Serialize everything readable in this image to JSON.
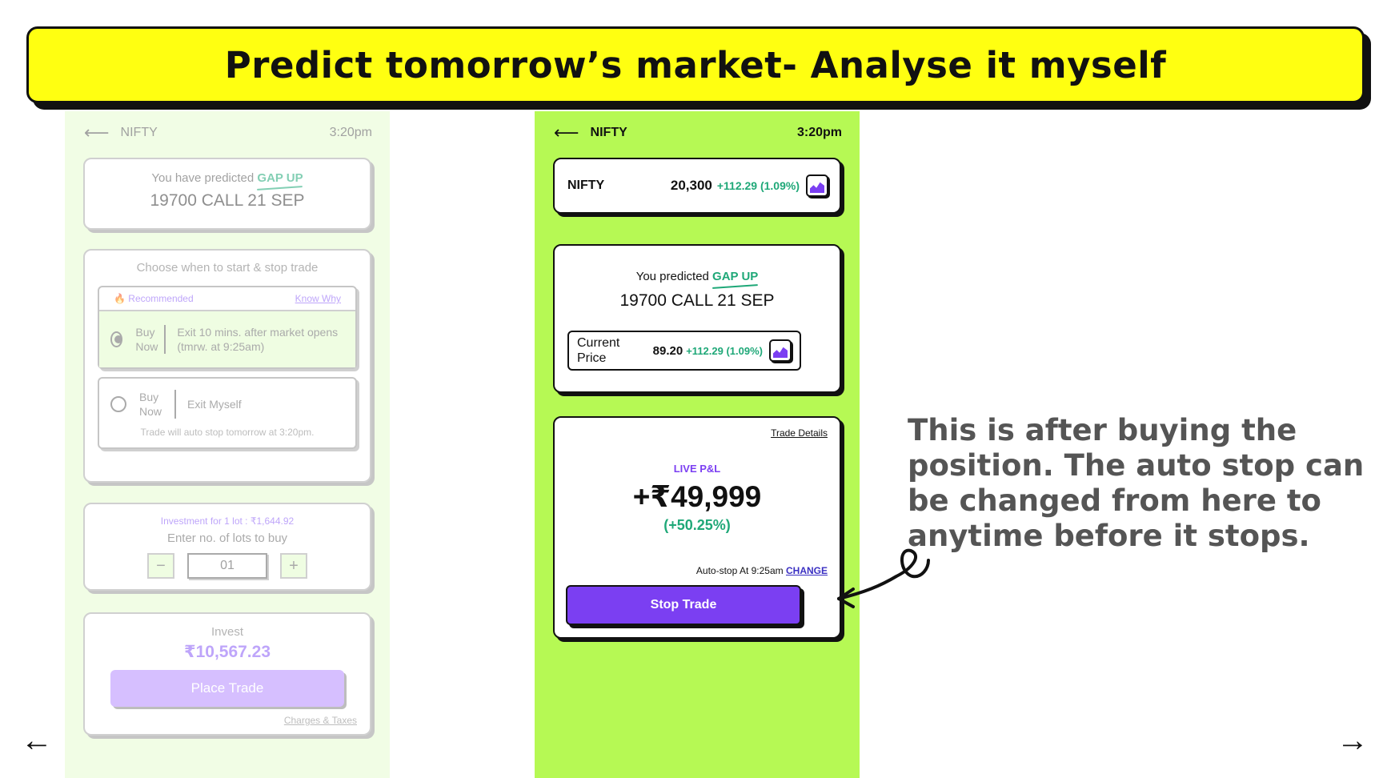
{
  "banner": {
    "title": "Predict tomorrow’s market- Analyse it myself"
  },
  "left_phone": {
    "back_icon": "arrow-left-icon",
    "title": "NIFTY",
    "time": "3:20pm",
    "prediction": {
      "prefix": "You have predicted",
      "direction": "GAP UP",
      "contract": "19700 CALL 21 SEP"
    },
    "choose": {
      "heading": "Choose when to start & stop trade",
      "recommended_label": "🔥 Recommended",
      "know_why": "Know Why",
      "option1": {
        "buy": "Buy Now",
        "exit": "Exit 10 mins. after market opens (tmrw. at 9:25am)",
        "selected": true
      },
      "option2": {
        "buy": "Buy Now",
        "exit": "Exit Myself",
        "note": "Trade will auto stop tomorrow at 3:20pm.",
        "selected": false
      }
    },
    "investment": {
      "per_lot": "Investment for 1 lot : ₹1,644.92",
      "prompt": "Enter no. of lots to buy",
      "minus": "−",
      "quantity": "01",
      "plus": "+"
    },
    "place": {
      "label": "Invest",
      "amount": "₹10,567.23",
      "button": "Place Trade",
      "charges": "Charges & Taxes"
    }
  },
  "right_phone": {
    "back_icon": "arrow-left-icon",
    "title": "NIFTY",
    "time": "3:20pm",
    "index": {
      "name": "NIFTY",
      "value": "20,300",
      "change": "+112.29 (1.09%)"
    },
    "prediction": {
      "prefix": "You predicted",
      "direction": "GAP UP",
      "contract": "19700 CALL 21 SEP"
    },
    "current": {
      "label_line1": "Current",
      "label_line2": "Price",
      "value": "89.20",
      "change": "+112.29 (1.09%)"
    },
    "pnl": {
      "trade_details": "Trade Details",
      "label": "LIVE P&L",
      "amount": "+₹49,999",
      "percent": "(+50.25%)",
      "auto_stop": "Auto-stop At 9:25am",
      "change_link": "CHANGE",
      "stop_button": "Stop Trade"
    }
  },
  "annotation": {
    "text": "This is after buying the position. The auto stop can be changed from here to anytime before it stops."
  },
  "nav": {
    "prev": "←",
    "next": "→"
  },
  "colors": {
    "banner": "#ffff11",
    "phone_bg": "#b6f954",
    "accent_purple": "#7b3ff2",
    "green": "#1fa878"
  }
}
